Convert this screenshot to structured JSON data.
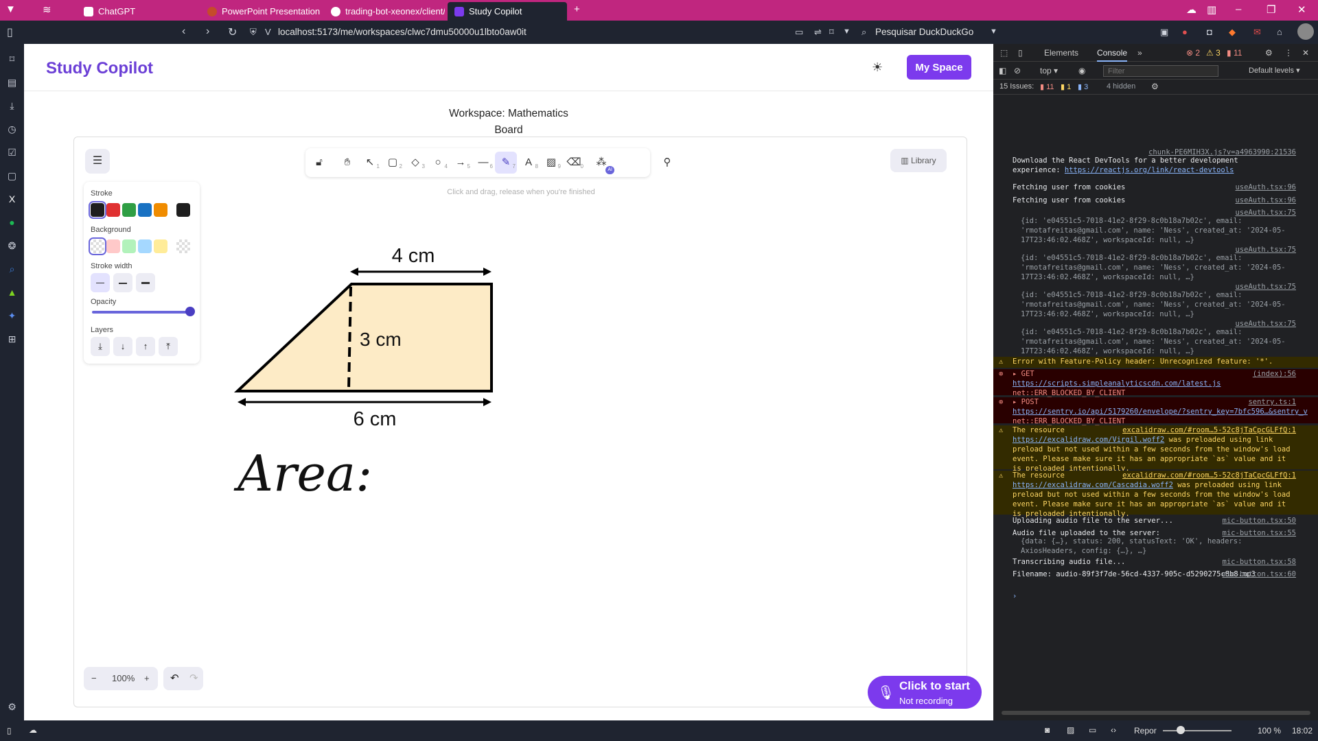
{
  "browser": {
    "tabs": [
      {
        "label": "ChatGPT",
        "active": false
      },
      {
        "label": "PowerPoint Presentation",
        "active": false
      },
      {
        "label": "trading-bot-xeonex/client/s",
        "active": false
      },
      {
        "label": "Study Copilot",
        "active": true
      }
    ],
    "url": "localhost:5173/me/workspaces/clwc7dmu50000u1lbto0aw0it",
    "search_placeholder": "Pesquisar DuckDuckGo",
    "accent": "#c0267f"
  },
  "app": {
    "brand": "Study Copilot",
    "my_space_label": "My Space",
    "workspace_title": "Workspace: Mathematics",
    "workspace_subtitle": "Board"
  },
  "excalidraw": {
    "hint": "Click and drag, release when you're finished",
    "library_label": "Library",
    "tools": [
      {
        "icon": "lock-icon",
        "key": ""
      },
      {
        "icon": "hand-icon",
        "key": ""
      },
      {
        "icon": "selection-icon",
        "key": "1"
      },
      {
        "icon": "rectangle-icon",
        "key": "2"
      },
      {
        "icon": "diamond-icon",
        "key": "3"
      },
      {
        "icon": "ellipse-icon",
        "key": "4"
      },
      {
        "icon": "arrow-icon",
        "key": "5"
      },
      {
        "icon": "line-icon",
        "key": "6"
      },
      {
        "icon": "draw-icon",
        "key": "7",
        "active": true
      },
      {
        "icon": "text-icon",
        "key": "8"
      },
      {
        "icon": "image-icon",
        "key": "9"
      },
      {
        "icon": "eraser-icon",
        "key": "0"
      },
      {
        "icon": "ai-icon",
        "key": ""
      }
    ],
    "ai_badge": "AI",
    "props": {
      "stroke_label": "Stroke",
      "stroke_colors": [
        "#1e1e1e",
        "#e03131",
        "#2f9e44",
        "#1971c2",
        "#f08c00"
      ],
      "stroke_current": "#1e1e1e",
      "background_label": "Background",
      "background_colors": [
        "transparent",
        "#ffc9c9",
        "#b2f2bb",
        "#a5d8ff",
        "#ffec99"
      ],
      "stroke_width_label": "Stroke width",
      "opacity_label": "Opacity",
      "opacity_value": 1.0,
      "layers_label": "Layers"
    },
    "zoom": "100%",
    "drawing": {
      "top_label": "4 cm",
      "height_label": "3 cm",
      "bottom_label": "6 cm",
      "handwriting": "Area:",
      "fill": "#fdebc6"
    }
  },
  "recorder": {
    "title": "Click to start",
    "subtitle": "Not recording"
  },
  "devtools": {
    "tabs": [
      "Elements",
      "Console"
    ],
    "error_count": "2",
    "warning_count": "3",
    "info_count": "11",
    "context": "top",
    "filter_placeholder": "Filter",
    "levels": "Default levels",
    "issues_label": "15 Issues:",
    "issues_errors": "11",
    "issues_warnings": "1",
    "issues_info": "3",
    "hidden": "4 hidden",
    "logs": [
      {
        "type": "source",
        "src": "chunk-PE6MIH3X.js?v=a4963990:21536"
      },
      {
        "type": "log",
        "text": "Download the React DevTools for a better development\nexperience: ",
        "link": "https://reactjs.org/link/react-devtools"
      },
      {
        "type": "log",
        "text": "Fetching user from cookies",
        "src": "useAuth.tsx:96"
      },
      {
        "type": "log",
        "text": "Fetching user from cookies",
        "src": "useAuth.tsx:96"
      },
      {
        "type": "obj",
        "src": "useAuth.tsx:75",
        "text": "{id: 'e04551c5-7018-41e2-8f29-8c0b18a7b02c', email: 'rmotafreitas@gmail.com', name: 'Ness', created_at: '2024-05-17T23:46:02.468Z', workspaceId: null, …}"
      },
      {
        "type": "obj",
        "src": "useAuth.tsx:75",
        "text": "{id: 'e04551c5-7018-41e2-8f29-8c0b18a7b02c', email: 'rmotafreitas@gmail.com', name: 'Ness', created_at: '2024-05-17T23:46:02.468Z', workspaceId: null, …}"
      },
      {
        "type": "obj",
        "src": "useAuth.tsx:75",
        "text": "{id: 'e04551c5-7018-41e2-8f29-8c0b18a7b02c', email: 'rmotafreitas@gmail.com', name: 'Ness', created_at: '2024-05-17T23:46:02.468Z', workspaceId: null, …}"
      },
      {
        "type": "obj",
        "src": "useAuth.tsx:75",
        "text": "{id: 'e04551c5-7018-41e2-8f29-8c0b18a7b02c', email: 'rmotafreitas@gmail.com', name: 'Ness', created_at: '2024-05-17T23:46:02.468Z', workspaceId: null, …}"
      },
      {
        "type": "warn",
        "text": "Error with Feature-Policy header: Unrecognized feature: '*'."
      },
      {
        "type": "err",
        "method": "GET",
        "src": "(index):56",
        "link": "https://scripts.simpleanalyticscdn.com/latest.js",
        "text": "net::ERR_BLOCKED_BY_CLIENT"
      },
      {
        "type": "err",
        "method": "POST",
        "src": "sentry.ts:1",
        "link": "https://sentry.io/api/5179260/envelope/?sentry_key=7bfc596…&sentry_v",
        "text": "net::ERR_BLOCKED_BY_CLIENT"
      },
      {
        "type": "warn",
        "src": "excalidraw.com/#room…5-52c8jTaCpcGLFfQ:1",
        "pre": "The resource ",
        "link": "https://excalidraw.com/Virgil.woff2",
        "text": " was preloaded using link preload but not used within a few seconds from the window's load event. Please make sure it has an appropriate `as` value and it is preloaded intentionally."
      },
      {
        "type": "warn",
        "src": "excalidraw.com/#room…5-52c8jTaCpcGLFfQ:1",
        "pre": "The resource ",
        "link": "https://excalidraw.com/Cascadia.woff2",
        "text": " was preloaded using link preload but not used within a few seconds from the window's load event. Please make sure it has an appropriate `as` value and it is preloaded intentionally."
      },
      {
        "type": "log",
        "text": "Uploading audio file to the server...",
        "src": "mic-button.tsx:50"
      },
      {
        "type": "log",
        "text": "Audio file uploaded to the server:",
        "src": "mic-button.tsx:55"
      },
      {
        "type": "obj",
        "text": "{data: {…}, status: 200, statusText: 'OK', headers: AxiosHeaders, config: {…}, …}"
      },
      {
        "type": "log",
        "text": "Transcribing audio file...",
        "src": "mic-button.tsx:58"
      },
      {
        "type": "log",
        "text": "Filename: audio-89f3f7de-56cd-4337-905c-d5290275c8b8.mp3",
        "src": "mic-button.tsx:60"
      }
    ]
  },
  "statusbar": {
    "reset_label": "Repor",
    "zoom": "100 %",
    "time": "18:02"
  }
}
